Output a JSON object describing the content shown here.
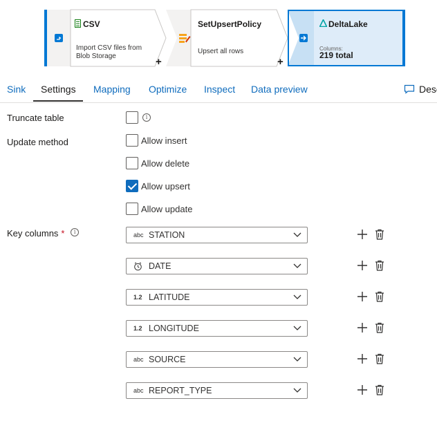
{
  "pipeline": {
    "nodes": [
      {
        "title": "CSV",
        "desc_line1": "Import CSV files from",
        "desc_line2": "Blob Storage",
        "icon": "csv-file-icon"
      },
      {
        "title": "SetUpsertPolicy",
        "desc_line1": "Upsert all rows",
        "icon": "alter-row-icon"
      },
      {
        "title": "DeltaLake",
        "meta_label": "Columns:",
        "meta_value": "219 total",
        "icon": "delta-lake-icon"
      }
    ],
    "add_symbol": "+"
  },
  "tabs": {
    "items": [
      {
        "label": "Sink"
      },
      {
        "label": "Settings"
      },
      {
        "label": "Mapping"
      },
      {
        "label": "Optimize"
      },
      {
        "label": "Inspect"
      },
      {
        "label": "Data preview"
      }
    ],
    "active": "Settings",
    "description_label": "Desc"
  },
  "settings": {
    "truncate_label": "Truncate table",
    "truncate_checked": false,
    "info_glyph": "i",
    "update_method_label": "Update method",
    "update_options": [
      {
        "label": "Allow insert",
        "checked": false
      },
      {
        "label": "Allow delete",
        "checked": false
      },
      {
        "label": "Allow upsert",
        "checked": true
      },
      {
        "label": "Allow update",
        "checked": false
      }
    ],
    "key_columns_label": "Key columns",
    "required_mark": "*",
    "key_columns": [
      {
        "type": "abc",
        "name": "STATION"
      },
      {
        "type": "date",
        "name": "DATE"
      },
      {
        "type": "1.2",
        "name": "LATITUDE"
      },
      {
        "type": "1.2",
        "name": "LONGITUDE"
      },
      {
        "type": "abc",
        "name": "SOURCE"
      },
      {
        "type": "abc",
        "name": "REPORT_TYPE"
      }
    ]
  },
  "colors": {
    "accent": "#0f6cbd",
    "selected_node_bg": "#deecf9",
    "node_border": "#0078d4",
    "required": "#c50f1f"
  }
}
